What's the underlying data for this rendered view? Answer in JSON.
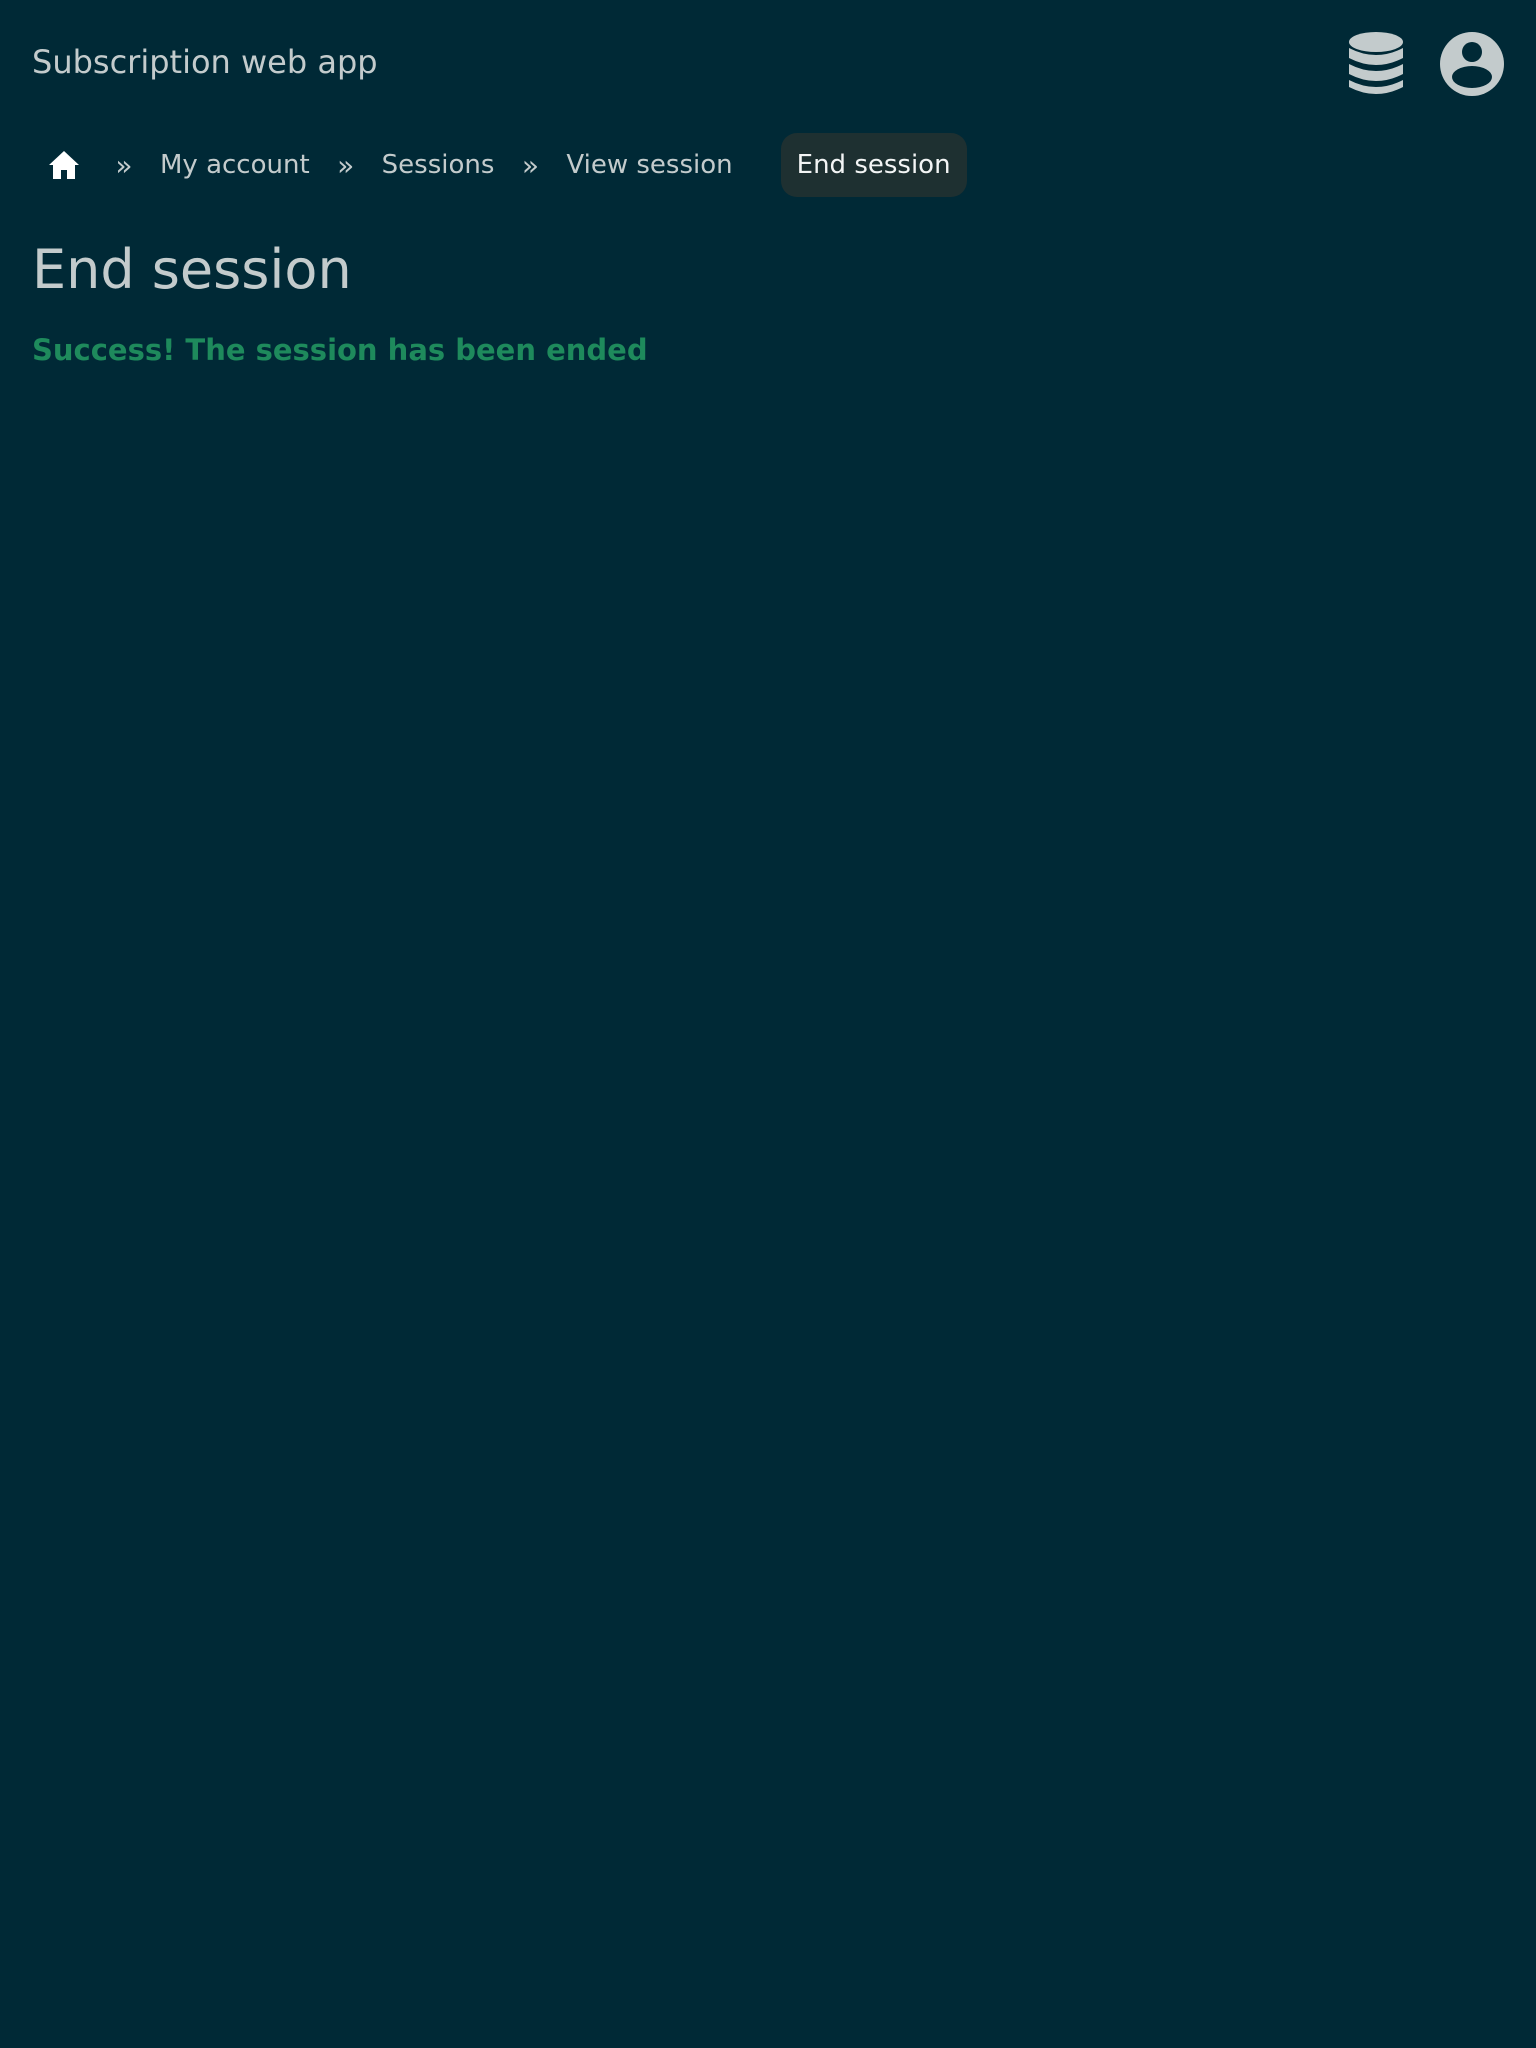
{
  "header": {
    "app_title": "Subscription web app",
    "database_icon": "database-icon",
    "account_icon": "user-circle-icon"
  },
  "breadcrumb": {
    "home_icon": "home-icon",
    "separator": "»",
    "items": [
      {
        "label": "My account"
      },
      {
        "label": "Sessions"
      },
      {
        "label": "View session"
      }
    ],
    "current": "End session"
  },
  "main": {
    "title": "End session",
    "message": "Success! The session has been ended"
  },
  "colors": {
    "background": "#002936",
    "text": "#c3cbcc",
    "current_crumb_bg": "#1e3031",
    "success": "#1e8a5c"
  }
}
